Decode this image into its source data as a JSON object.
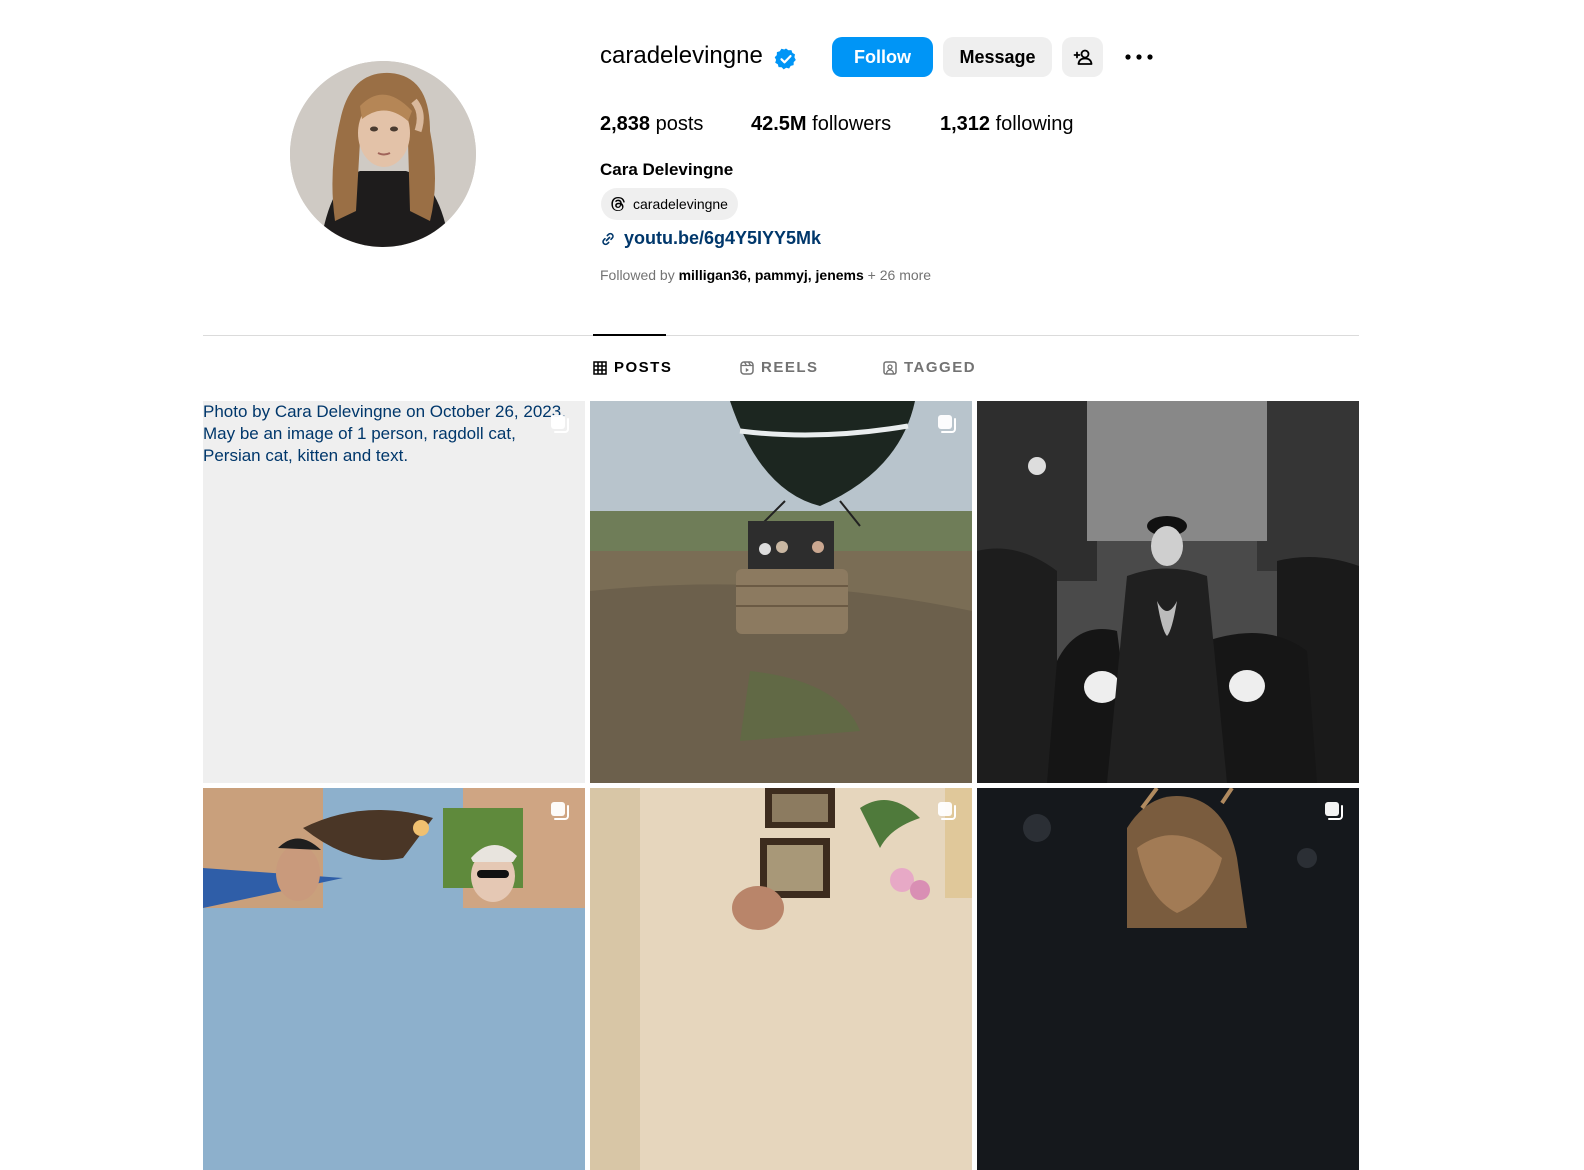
{
  "profile": {
    "username": "caradelevingne",
    "full_name": "Cara Delevingne",
    "threads_handle": "caradelevingne",
    "link": "youtu.be/6g4Y5IYY5Mk",
    "followed_by_prefix": "Followed by",
    "followed_by_names": "milligan36, pammyj, jenems",
    "followed_by_more": "+ 26 more",
    "verified": true
  },
  "buttons": {
    "follow": "Follow",
    "message": "Message"
  },
  "stats": {
    "posts_count": "2,838",
    "posts_label": "posts",
    "followers_count": "42.5M",
    "followers_label": "followers",
    "following_count": "1,312",
    "following_label": "following"
  },
  "tabs": [
    {
      "label": "POSTS",
      "active": true,
      "icon": "grid-icon"
    },
    {
      "label": "REELS",
      "active": false,
      "icon": "reels-icon"
    },
    {
      "label": "TAGGED",
      "active": false,
      "icon": "tagged-icon"
    }
  ],
  "posts": [
    {
      "alt": "Photo by Cara Delevingne on October 26, 2023. May be an image of 1 person, ragdoll cat, Persian cat, kitten and text.",
      "broken": true,
      "multi": true
    },
    {
      "subject": "hot-air-balloon",
      "multi": true
    },
    {
      "subject": "street-scene-black-and-white",
      "multi": false
    },
    {
      "subject": "falcon-outdoors",
      "multi": true
    },
    {
      "subject": "room-with-flowers",
      "multi": true
    },
    {
      "subject": "night-portrait",
      "multi": true
    }
  ],
  "colors": {
    "accent": "#0095f6",
    "link": "#00376b",
    "muted": "#737373",
    "button_gray": "#efefef",
    "divider": "#dbdbdb"
  }
}
